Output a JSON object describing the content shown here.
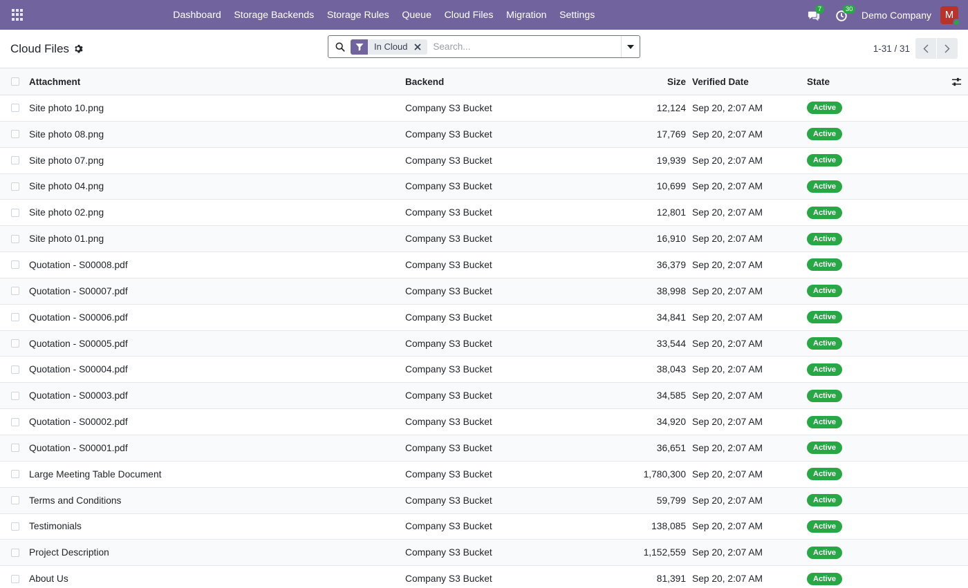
{
  "navbar": {
    "menu": [
      "Dashboard",
      "Storage Backends",
      "Storage Rules",
      "Queue",
      "Cloud Files",
      "Migration",
      "Settings"
    ],
    "messages_count": "7",
    "activities_count": "30",
    "company": "Demo Company",
    "avatar_initial": "M",
    "brand_color": "#71639e"
  },
  "control": {
    "title": "Cloud Files",
    "facet_label": "In Cloud",
    "search_placeholder": "Search...",
    "pager_value": "1-31 / 31"
  },
  "table": {
    "headers": {
      "attachment": "Attachment",
      "backend": "Backend",
      "size": "Size",
      "verified_date": "Verified Date",
      "state": "State"
    },
    "rows": [
      {
        "attachment": "Site photo 10.png",
        "backend": "Company S3 Bucket",
        "size": "12,124",
        "date": "Sep 20, 2:07 AM",
        "state": "Active"
      },
      {
        "attachment": "Site photo 08.png",
        "backend": "Company S3 Bucket",
        "size": "17,769",
        "date": "Sep 20, 2:07 AM",
        "state": "Active"
      },
      {
        "attachment": "Site photo 07.png",
        "backend": "Company S3 Bucket",
        "size": "19,939",
        "date": "Sep 20, 2:07 AM",
        "state": "Active"
      },
      {
        "attachment": "Site photo 04.png",
        "backend": "Company S3 Bucket",
        "size": "10,699",
        "date": "Sep 20, 2:07 AM",
        "state": "Active"
      },
      {
        "attachment": "Site photo 02.png",
        "backend": "Company S3 Bucket",
        "size": "12,801",
        "date": "Sep 20, 2:07 AM",
        "state": "Active"
      },
      {
        "attachment": "Site photo 01.png",
        "backend": "Company S3 Bucket",
        "size": "16,910",
        "date": "Sep 20, 2:07 AM",
        "state": "Active"
      },
      {
        "attachment": "Quotation - S00008.pdf",
        "backend": "Company S3 Bucket",
        "size": "36,379",
        "date": "Sep 20, 2:07 AM",
        "state": "Active"
      },
      {
        "attachment": "Quotation - S00007.pdf",
        "backend": "Company S3 Bucket",
        "size": "38,998",
        "date": "Sep 20, 2:07 AM",
        "state": "Active"
      },
      {
        "attachment": "Quotation - S00006.pdf",
        "backend": "Company S3 Bucket",
        "size": "34,841",
        "date": "Sep 20, 2:07 AM",
        "state": "Active"
      },
      {
        "attachment": "Quotation - S00005.pdf",
        "backend": "Company S3 Bucket",
        "size": "33,544",
        "date": "Sep 20, 2:07 AM",
        "state": "Active"
      },
      {
        "attachment": "Quotation - S00004.pdf",
        "backend": "Company S3 Bucket",
        "size": "38,043",
        "date": "Sep 20, 2:07 AM",
        "state": "Active"
      },
      {
        "attachment": "Quotation - S00003.pdf",
        "backend": "Company S3 Bucket",
        "size": "34,585",
        "date": "Sep 20, 2:07 AM",
        "state": "Active"
      },
      {
        "attachment": "Quotation - S00002.pdf",
        "backend": "Company S3 Bucket",
        "size": "34,920",
        "date": "Sep 20, 2:07 AM",
        "state": "Active"
      },
      {
        "attachment": "Quotation - S00001.pdf",
        "backend": "Company S3 Bucket",
        "size": "36,651",
        "date": "Sep 20, 2:07 AM",
        "state": "Active"
      },
      {
        "attachment": "Large Meeting Table Document",
        "backend": "Company S3 Bucket",
        "size": "1,780,300",
        "date": "Sep 20, 2:07 AM",
        "state": "Active"
      },
      {
        "attachment": "Terms and Conditions",
        "backend": "Company S3 Bucket",
        "size": "59,799",
        "date": "Sep 20, 2:07 AM",
        "state": "Active"
      },
      {
        "attachment": "Testimonials",
        "backend": "Company S3 Bucket",
        "size": "138,085",
        "date": "Sep 20, 2:07 AM",
        "state": "Active"
      },
      {
        "attachment": "Project Description",
        "backend": "Company S3 Bucket",
        "size": "1,152,559",
        "date": "Sep 20, 2:07 AM",
        "state": "Active"
      },
      {
        "attachment": "About Us",
        "backend": "Company S3 Bucket",
        "size": "81,391",
        "date": "Sep 20, 2:07 AM",
        "state": "Active"
      }
    ]
  }
}
